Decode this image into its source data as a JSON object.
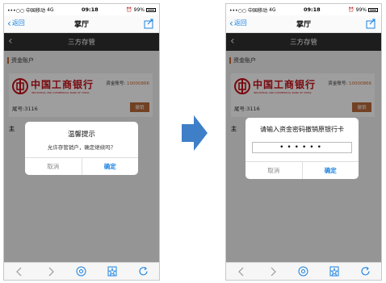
{
  "colors": {
    "ios_blue": "#1a82e2",
    "bank_red": "#c40f18",
    "accent_brown": "#b96a3a",
    "titlebar_dark": "#2f2f2f",
    "arrow_blue": "#3f7fc8"
  },
  "screens": [
    {
      "status": {
        "carrier": "•••○○ 中国移动",
        "network": "4G",
        "time": "09:18",
        "battery": "99%"
      },
      "nav": {
        "back_label": "返回",
        "title": "掌厅",
        "share_icon": "share-icon"
      },
      "page": {
        "title": "三方存管",
        "back_icon": "chevron-left-icon"
      },
      "section": {
        "header": "资金账户"
      },
      "card": {
        "bank_name": "中国工商银行",
        "bank_name_en": "INDUSTRIAL AND COMMERCIAL BANK OF CHINA",
        "account_label": "资金账号:",
        "account_no": "10000866",
        "tail_label": "尾号:3116",
        "cancel_label": "撤销"
      },
      "note": "主",
      "dialog": {
        "title": "温馨提示",
        "message": "允许存管销户，确定继续吗？",
        "cancel": "取消",
        "confirm": "确定"
      }
    },
    {
      "status": {
        "carrier": "•••○○ 中国移动",
        "network": "4G",
        "time": "09:18",
        "battery": "99%"
      },
      "nav": {
        "back_label": "返回",
        "title": "掌厅",
        "share_icon": "share-icon"
      },
      "page": {
        "title": "三方存管",
        "back_icon": "chevron-left-icon"
      },
      "section": {
        "header": "资金账户"
      },
      "card": {
        "bank_name": "中国工商银行",
        "bank_name_en": "INDUSTRIAL AND COMMERCIAL BANK OF CHINA",
        "account_label": "资金账号:",
        "account_no": "10000866",
        "tail_label": "尾号:3116",
        "cancel_label": "撤销"
      },
      "note": "主",
      "dialog": {
        "title": "请输入资金密码撤销原银行卡",
        "password_mask": "••••••",
        "cancel": "取消",
        "confirm": "确定"
      }
    }
  ],
  "toolbar_icons": [
    "back-arrow-icon",
    "forward-arrow-icon",
    "at-icon",
    "bookmark-star-icon",
    "refresh-icon"
  ],
  "arrow": {
    "icon": "right-arrow-icon"
  }
}
